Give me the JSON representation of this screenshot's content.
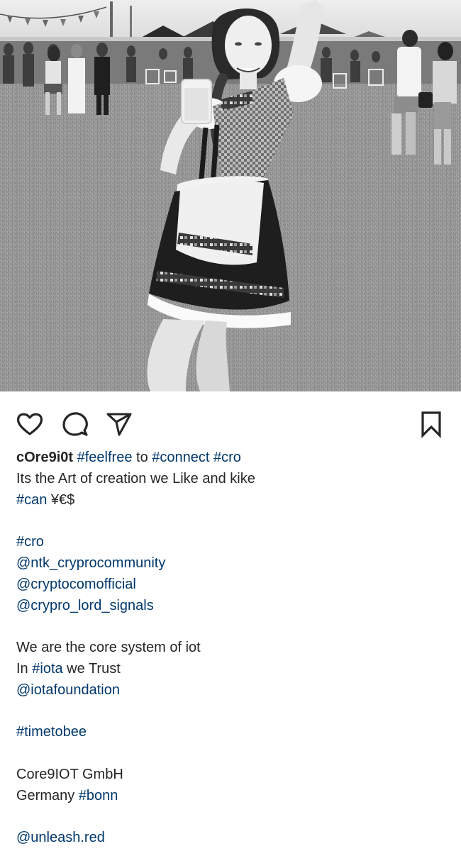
{
  "post": {
    "image": {
      "description_icon": "photo-woman-in-dirndl-at-festival"
    },
    "actions": {
      "like_icon": "heart-outline-icon",
      "comment_icon": "comment-bubble-icon",
      "share_icon": "paper-plane-icon",
      "save_icon": "bookmark-outline-icon"
    },
    "caption": {
      "username": "cOre9i0t",
      "line1": {
        "tag_feelfree": "#feelfree",
        "word_to": " to ",
        "tag_connect": "#connect",
        "tag_cro": "#cro"
      },
      "line2": "Its the Art of creation we Like and kike",
      "line3": {
        "tag_can": "#can",
        "text": " ¥€$"
      },
      "line5": "#cro",
      "line6": "@ntk_cryprocommunity",
      "line7": "@cryptocomofficial",
      "line8": "@crypro_lord_signals",
      "line10": "We are the core system of iot",
      "line11": {
        "text": "In ",
        "tag_iota": "#iota",
        "text_after": " we Trust"
      },
      "line12": "@iotafoundation",
      "line14": "#timetobee",
      "line16": "Core9IOT GmbH",
      "line17": {
        "text": "Germany ",
        "tag_bonn": "#bonn"
      },
      "line19": "@unleash.red"
    }
  },
  "colors": {
    "text": "#262626",
    "link": "#00376b",
    "background": "#ffffff"
  }
}
